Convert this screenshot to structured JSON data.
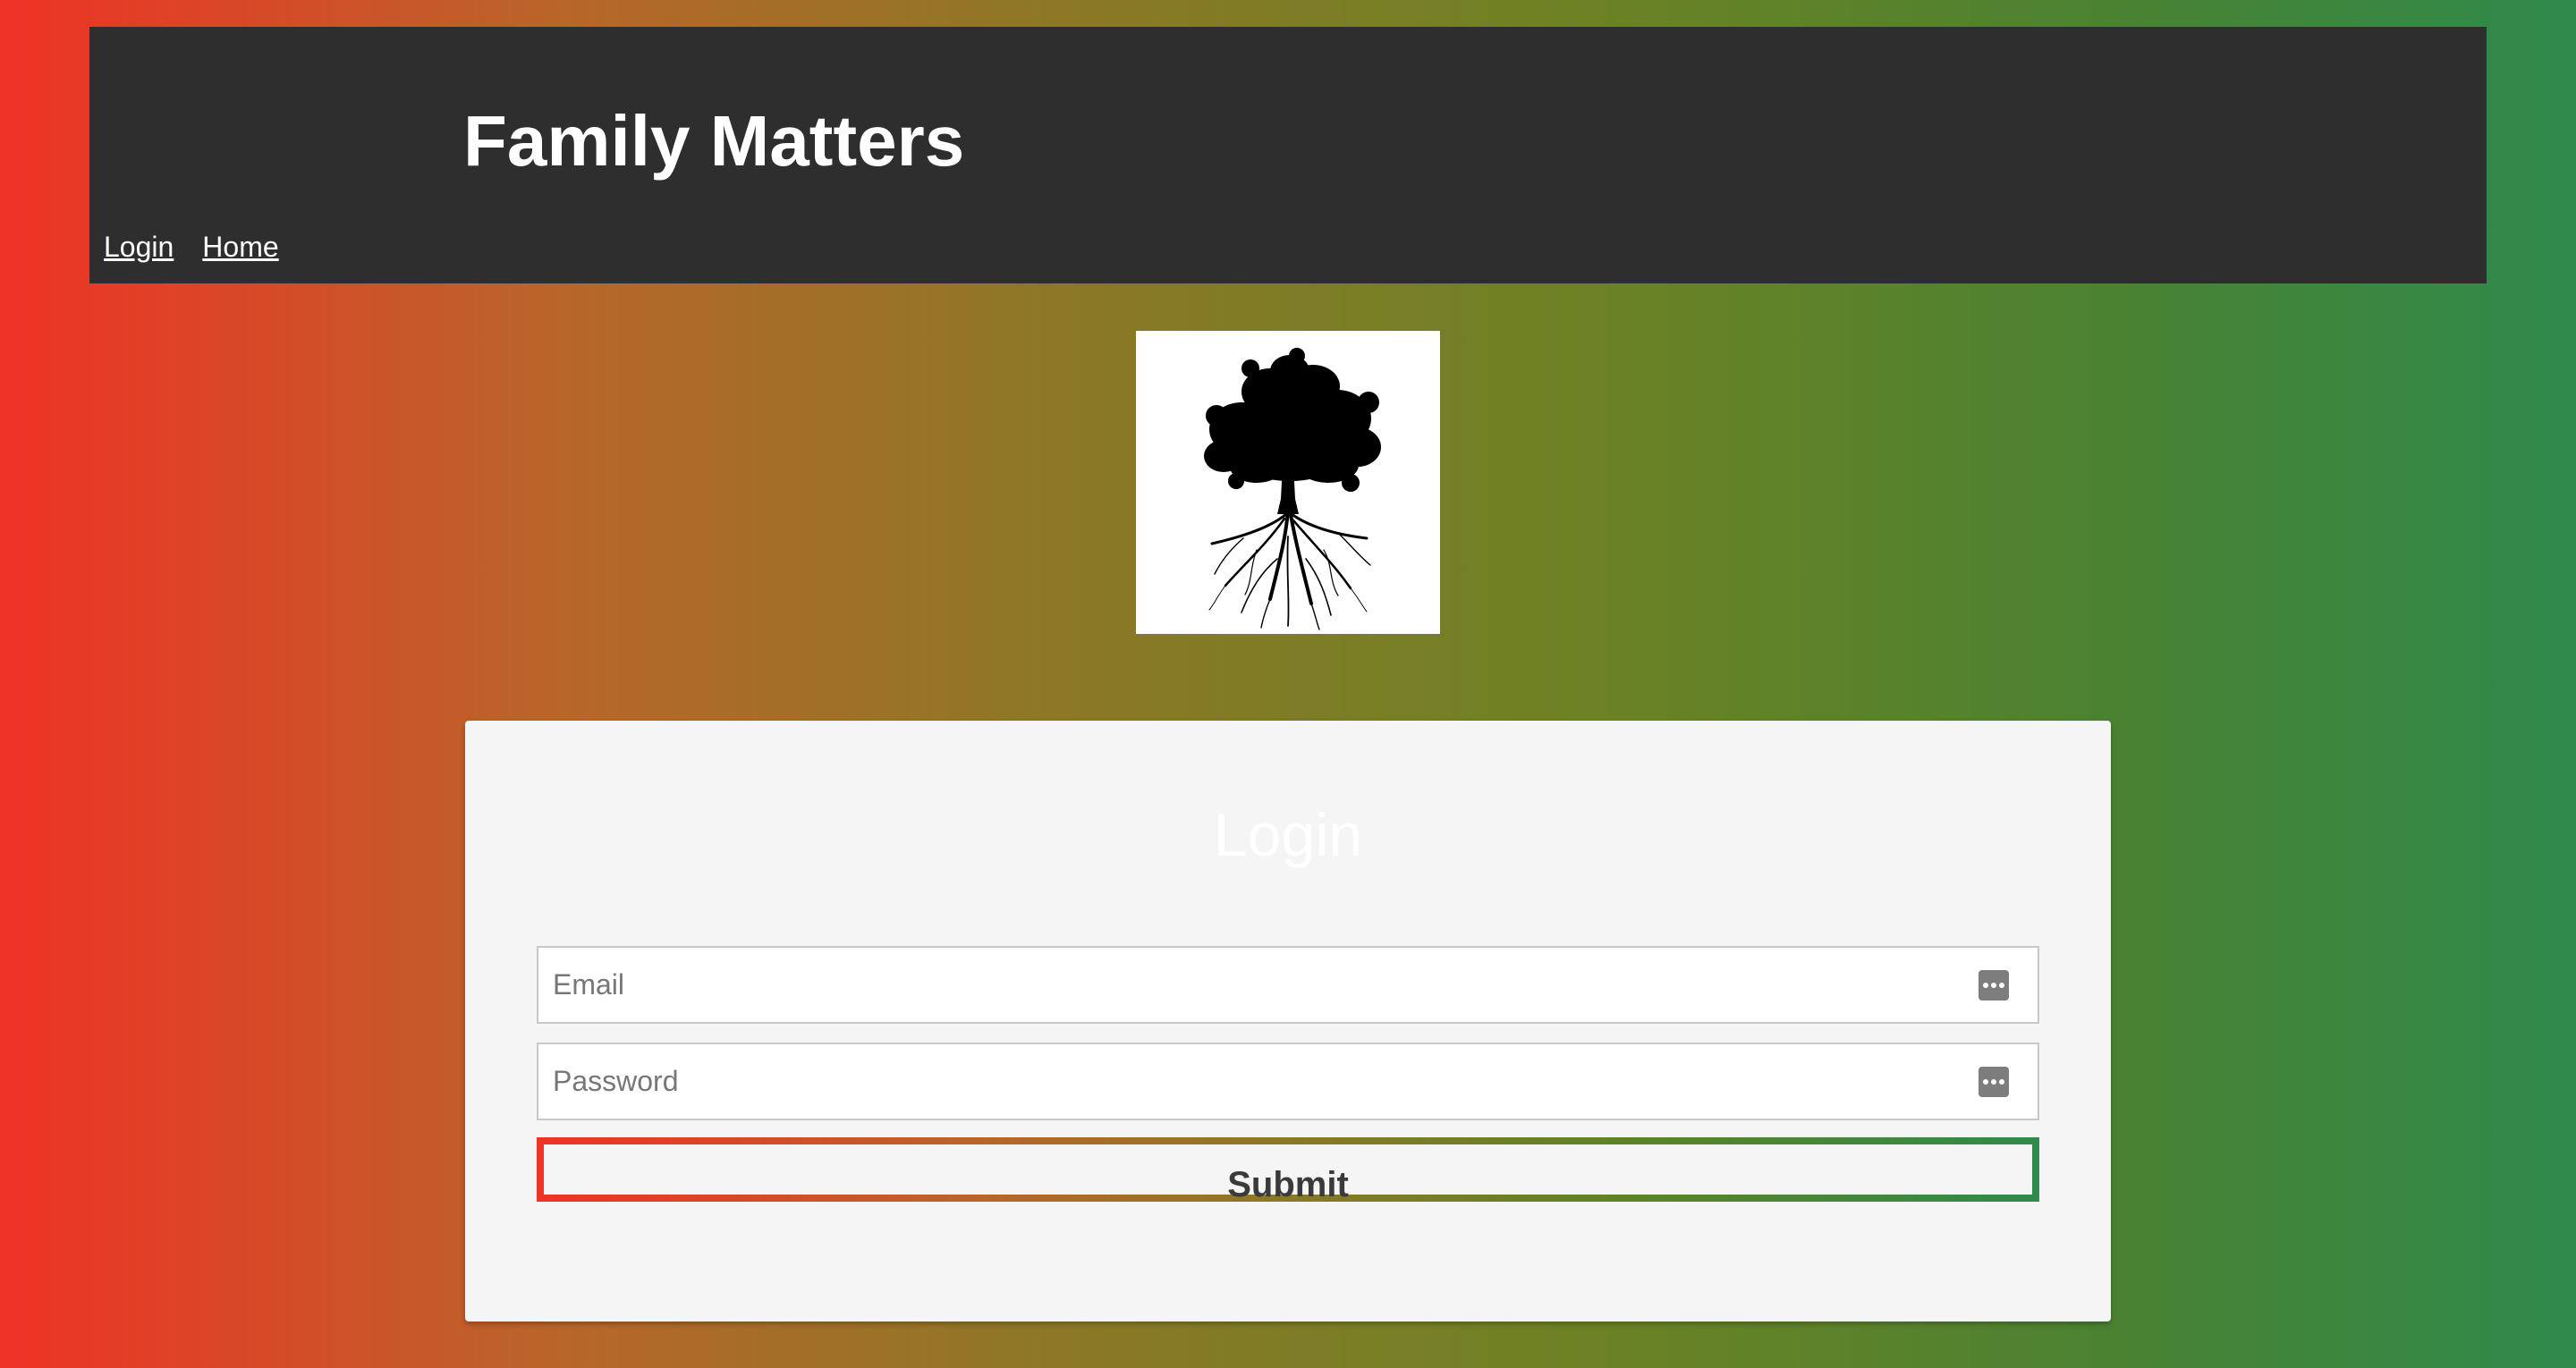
{
  "header": {
    "title": "Family Matters",
    "nav": [
      {
        "label": "Login"
      },
      {
        "label": "Home"
      }
    ]
  },
  "logo": {
    "icon": "tree-with-roots-icon"
  },
  "login_form": {
    "title": "Login",
    "email": {
      "placeholder": "Email",
      "value": ""
    },
    "password": {
      "placeholder": "Password",
      "value": ""
    },
    "submit_label": "Submit"
  },
  "colors": {
    "header_bg": "#2e2e2e",
    "gradient_start": "#ef3226",
    "gradient_end": "#2f8a4c",
    "card_bg": "#f5f5f5"
  }
}
